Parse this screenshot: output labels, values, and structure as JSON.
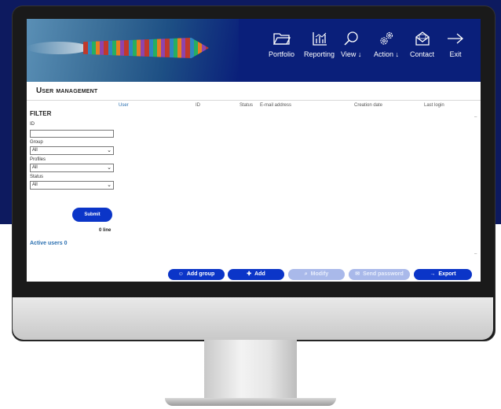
{
  "header": {
    "nav": [
      {
        "label": "Portfolio",
        "icon": "folder-icon"
      },
      {
        "label": "Reporting",
        "icon": "chart-icon"
      },
      {
        "label": "View ↓",
        "icon": "search-icon"
      },
      {
        "label": "Action ↓",
        "icon": "gears-icon"
      },
      {
        "label": "Contact",
        "icon": "mail-icon"
      },
      {
        "label": "Exit",
        "icon": "arrow-right-icon"
      }
    ]
  },
  "page": {
    "title": "User management"
  },
  "filter": {
    "heading": "FILTER",
    "id_label": "ID",
    "id_value": "",
    "group_label": "Group",
    "group_value": "All",
    "profiles_label": "Profiles",
    "profiles_value": "All",
    "status_label": "Status",
    "status_value": "All",
    "submit_label": "Submit",
    "line_count": "0 line",
    "active_users": "Active users 0"
  },
  "table": {
    "columns": [
      "User",
      "ID",
      "Status",
      "E-mail address",
      "Creation date",
      "Last login"
    ],
    "rows": []
  },
  "actions": {
    "add_group": "Add group",
    "add": "Add",
    "modify": "Modify",
    "send_password": "Send password",
    "export": "Export"
  },
  "colors": {
    "brand_blue": "#0a1f7a",
    "button_blue": "#0b35c8",
    "link_blue": "#2a6fb0",
    "disabled_blue": "#a9b9ea"
  }
}
